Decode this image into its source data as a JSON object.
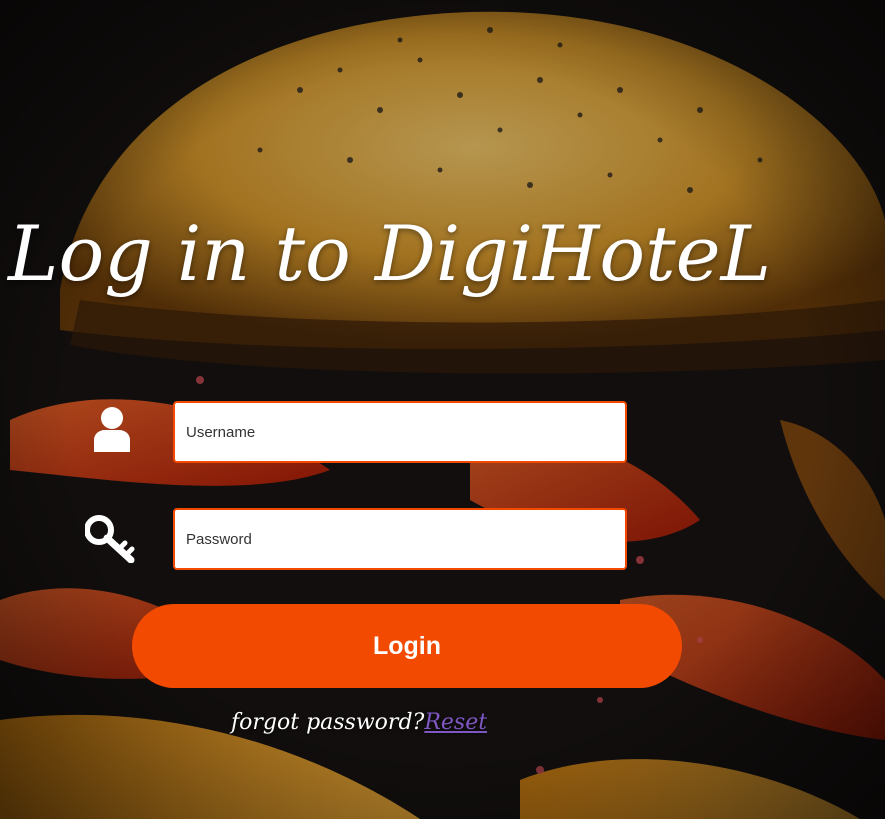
{
  "header": {
    "title": "Log in to DigiHoteL"
  },
  "form": {
    "username_placeholder": "Username",
    "password_placeholder": "Password",
    "login_label": "Login"
  },
  "footer": {
    "forgot_text": "forgot password?",
    "reset_label": "Reset"
  },
  "icons": {
    "username": "user-icon",
    "password": "key-icon"
  },
  "colors": {
    "accent": "#f24a00",
    "link": "#7e57c2",
    "text": "#ffffff"
  }
}
